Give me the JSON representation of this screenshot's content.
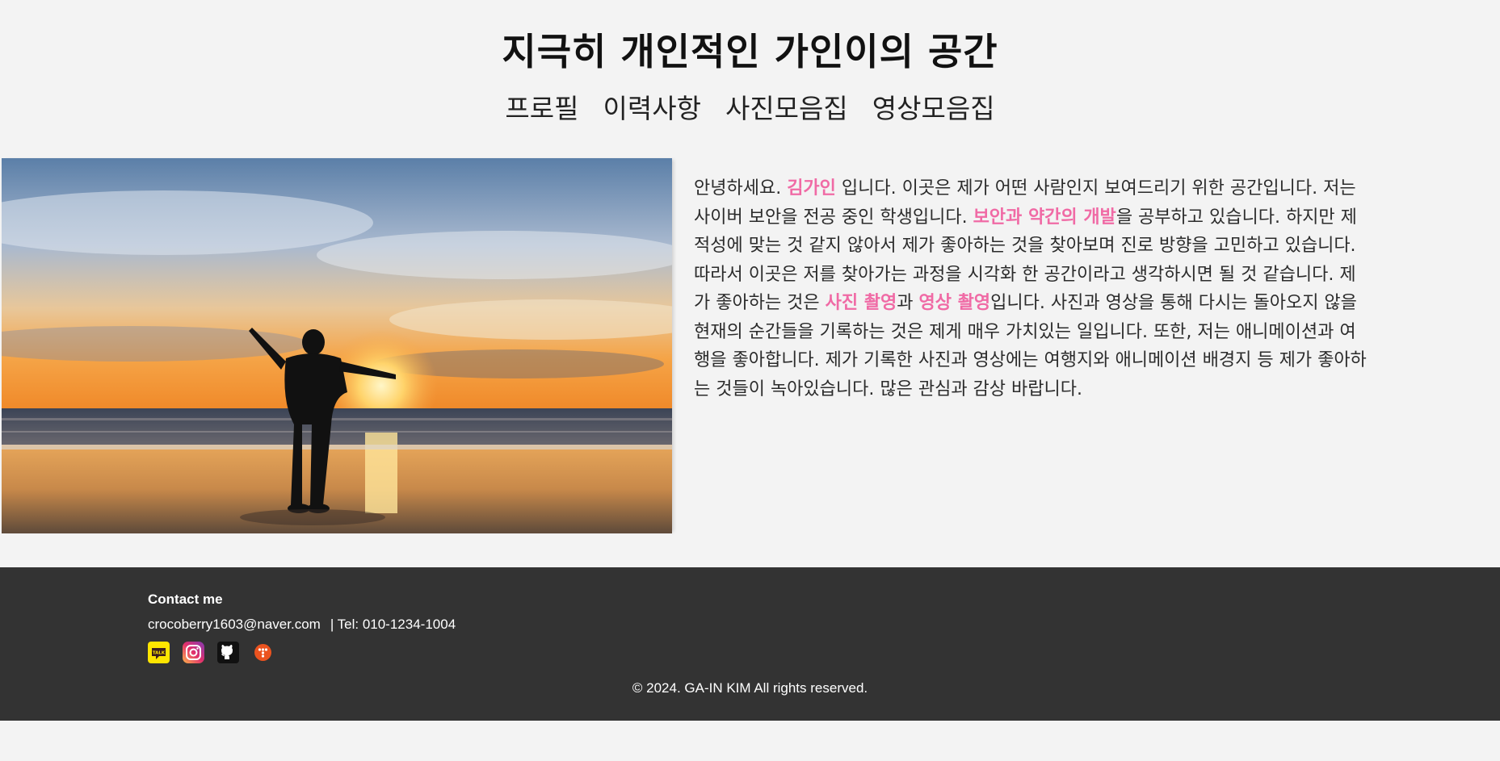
{
  "header": {
    "title": "지극히 개인적인 가인이의 공간"
  },
  "nav": {
    "items": [
      "프로필",
      "이력사항",
      "사진모음집",
      "영상모음집"
    ]
  },
  "intro": {
    "p1": "안녕하세요. ",
    "name": "김가인",
    "p2": " 입니다. 이곳은 제가 어떤 사람인지 보여드리기 위한 공간입니다. 저는 사이버 보안을 전공 중인 학생입니다. ",
    "h1": "보안과 약간의 개발",
    "p3": "을 공부하고 있습니다. 하지만 제 적성에 맞는 것 같지 않아서 제가 좋아하는 것을 찾아보며 진로 방향을 고민하고 있습니다. 따라서 이곳은 저를 찾아가는 과정을 시각화 한 공간이라고 생각하시면 될 것 같습니다. 제가 좋아하는 것은 ",
    "h2": "사진 촬영",
    "p4": "과 ",
    "h3": "영상 촬영",
    "p5": "입니다. 사진과 영상을 통해 다시는 돌아오지 않을 현재의 순간들을 기록하는 것은 제게 매우 가치있는 일입니다. 또한, 저는 애니메이션과 여행을 좋아합니다. 제가 기록한 사진과 영상에는 여행지와 애니메이션 배경지 등 제가 좋아하는 것들이 녹아있습니다. 많은 관심과 감상 바랍니다."
  },
  "footer": {
    "contact_heading": "Contact me",
    "email": "crocoberry1603@naver.com",
    "tel": "| Tel: 010-1234-1004",
    "socials": [
      "kakaotalk-icon",
      "instagram-icon",
      "github-icon",
      "tistory-icon"
    ],
    "kakao_label": "TALK",
    "copyright": "© 2024. GA-IN KIM All rights reserved."
  },
  "colors": {
    "highlight": "#f06aa5",
    "footer_bg": "#333333",
    "page_bg": "#f3f3f3"
  }
}
